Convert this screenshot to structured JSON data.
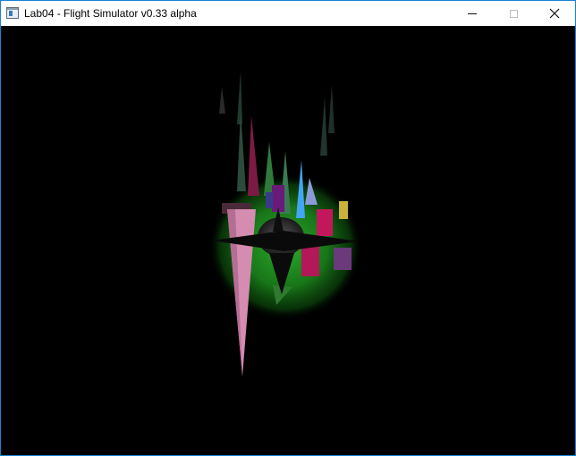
{
  "window": {
    "title": "Lab04 - Flight Simulator v0.33 alpha",
    "icon": "application-window-icon"
  },
  "controls": {
    "minimize": "minimize-icon",
    "maximize": "maximize-icon",
    "close": "close-icon"
  },
  "scene": {
    "background": "#000000",
    "ground_color": "#1e8a1e",
    "building_colors": [
      "#d98fb4",
      "#c2185b",
      "#7b1fa2",
      "#42a5f5",
      "#e91e63",
      "#ffeb3b",
      "#2e7d32"
    ]
  }
}
